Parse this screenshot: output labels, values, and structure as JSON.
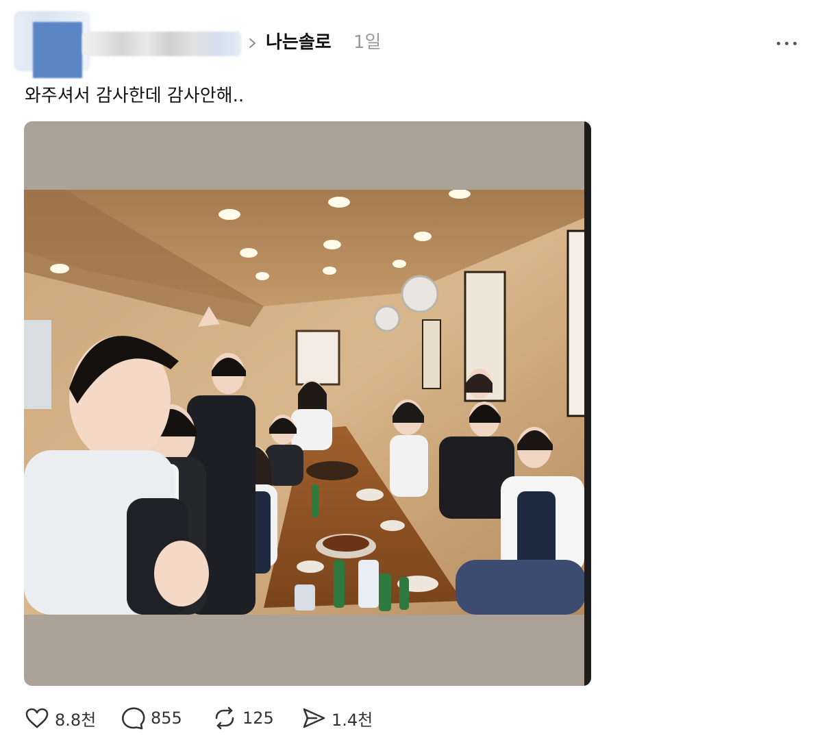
{
  "header": {
    "community_name": "나는솔로",
    "time": "1일"
  },
  "post": {
    "text": "와주셔서 감사한데 감사안해.."
  },
  "actions": {
    "like_count": "8.8천",
    "comment_count": "855",
    "repost_count": "125",
    "share_count": "1.4천"
  },
  "icons": {
    "like": "heart-icon",
    "comment": "comment-bubble-icon",
    "repost": "repost-icon",
    "share": "send-icon",
    "more": "more-dots-icon",
    "chevron": "chevron-right-icon"
  },
  "colors": {
    "text": "#111111",
    "muted": "#9a9a9a",
    "photo_frame": "#aba197"
  }
}
